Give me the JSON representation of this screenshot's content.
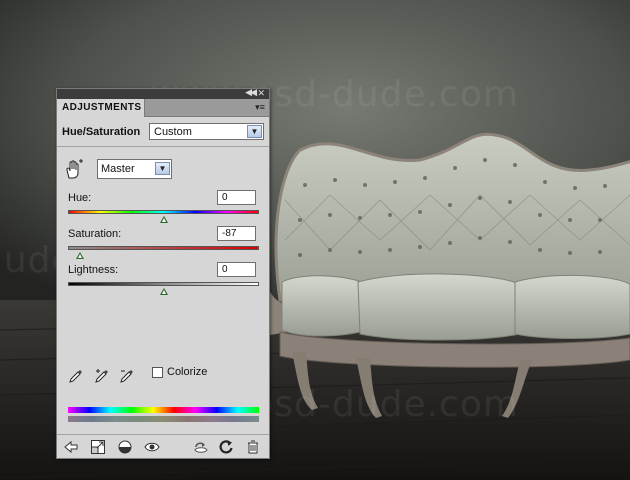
{
  "background": {
    "watermark_text_1": "www.psd-dude.com",
    "watermark_text_2": "dude.com",
    "watermark_text_3": "www.psd-dude.com"
  },
  "panel": {
    "tab_label": "ADJUSTMENTS",
    "adjustment_title": "Hue/Saturation",
    "preset_value": "Custom",
    "channel_value": "Master",
    "hue": {
      "label": "Hue:",
      "value": "0",
      "level": 0.5
    },
    "saturation": {
      "label": "Saturation:",
      "value": "-87",
      "level": 0.065
    },
    "lightness": {
      "label": "Lightness:",
      "value": "0",
      "level": 0.5
    },
    "colorize_label": "Colorize",
    "colorize_checked": false
  },
  "icons": {
    "hand": "hand-adjust-icon",
    "eyedroppers": [
      "eyedropper-icon",
      "eyedropper-plus-icon",
      "eyedropper-minus-icon"
    ],
    "footer": [
      "back-arrow-icon",
      "expand-view-icon",
      "clip-to-layer-icon",
      "visibility-eye-icon",
      "view-previous-icon",
      "reset-icon",
      "trash-icon"
    ]
  },
  "colors": {
    "panel_bg": "#d6d6d6",
    "slider_thumb": "#2b6b2b",
    "dropdown_accent": "#b7c9e6"
  }
}
